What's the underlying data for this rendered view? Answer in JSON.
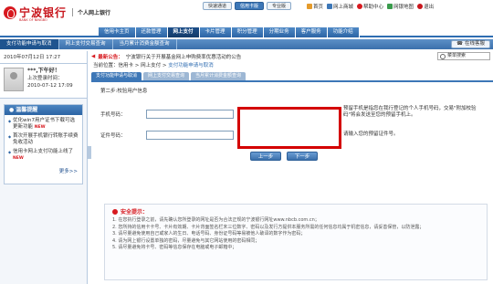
{
  "brand": {
    "name_cn": "宁波银行",
    "name_en": "BANK OF NINGBO",
    "product": "个人网上银行"
  },
  "quick_tabs": [
    "快速通道",
    "信用卡版",
    "专业版"
  ],
  "top_links": [
    "首页",
    "网上商城",
    "帮助中心",
    "网银地图",
    "退出"
  ],
  "nav": [
    "信用卡主页",
    "还款管理",
    "网上支付",
    "卡片管理",
    "积分管理",
    "分期业务",
    "客户服务",
    "功能介绍"
  ],
  "subnav": [
    "支付功能申请与取消",
    "网上支付交易查询",
    "当月累计消费金额查询"
  ],
  "kefu": "在线客服",
  "side": {
    "date": "2010年07月12日 17:27",
    "greeting": "***,下午好！",
    "last_login_label": "上次登录时间：",
    "last_login": "2010-07-12 17:09",
    "notice_title": "温馨提醒",
    "notices": [
      "优化win7用户证书下载可选更新功能",
      "首次开展手机银行转账手续费免收活动",
      "信用卡网上支付功能上线了"
    ],
    "new_tag": "NEW",
    "more": "更多>>"
  },
  "news": {
    "label": "最新公告：",
    "text": "宁波银行关于开展基金网上申购费率优惠活动的公告"
  },
  "search_placeholder": "菜单搜索",
  "breadcrumb": {
    "prefix": "当前位置：",
    "path": "信用卡 > 网上支付 > ",
    "current": "支付功能申请与取消"
  },
  "content_tabs": [
    "支付功能申请与取消",
    "网上支付交易查询",
    "当月累计消费金额查询"
  ],
  "step": "第二步:校验用户信息",
  "form": {
    "phone_label": "手机号码：",
    "phone_value": "",
    "code_label": "证件号码：",
    "code_value": "",
    "phone_hint": "预留手机是指您在我行登记的个人手机号码，交易\"附加校验码\"将会发送至您的预留手机上。",
    "code_hint": "请输入您的预留证件号。"
  },
  "buttons": {
    "prev": "上一步",
    "next": "下一步"
  },
  "safety": {
    "title": "安全提示：",
    "items": [
      "1. 在您执行登录之前，请先确认您所登录的网址是否为合法正规的宁波银行网址www.nbcb.com.cn；",
      "2. 您所持的信用卡卡号、卡片有效期、卡片背面签名栏末三位数字、密码以及发行方提供本服务所需的任何信息均属于机密信息，请妥善保管，以防泄露；",
      "3. 请尽量避免使用自己或家人的生日、电话号码、身份证号码等易被他人破译的数字作为密码；",
      "4. 请为网上银行设置单独的密码，尽量避免与其它网站使用的密码相同；",
      "5. 请尽量避免将卡号、密码等信息保存在电脑或电子邮箱中；"
    ]
  }
}
